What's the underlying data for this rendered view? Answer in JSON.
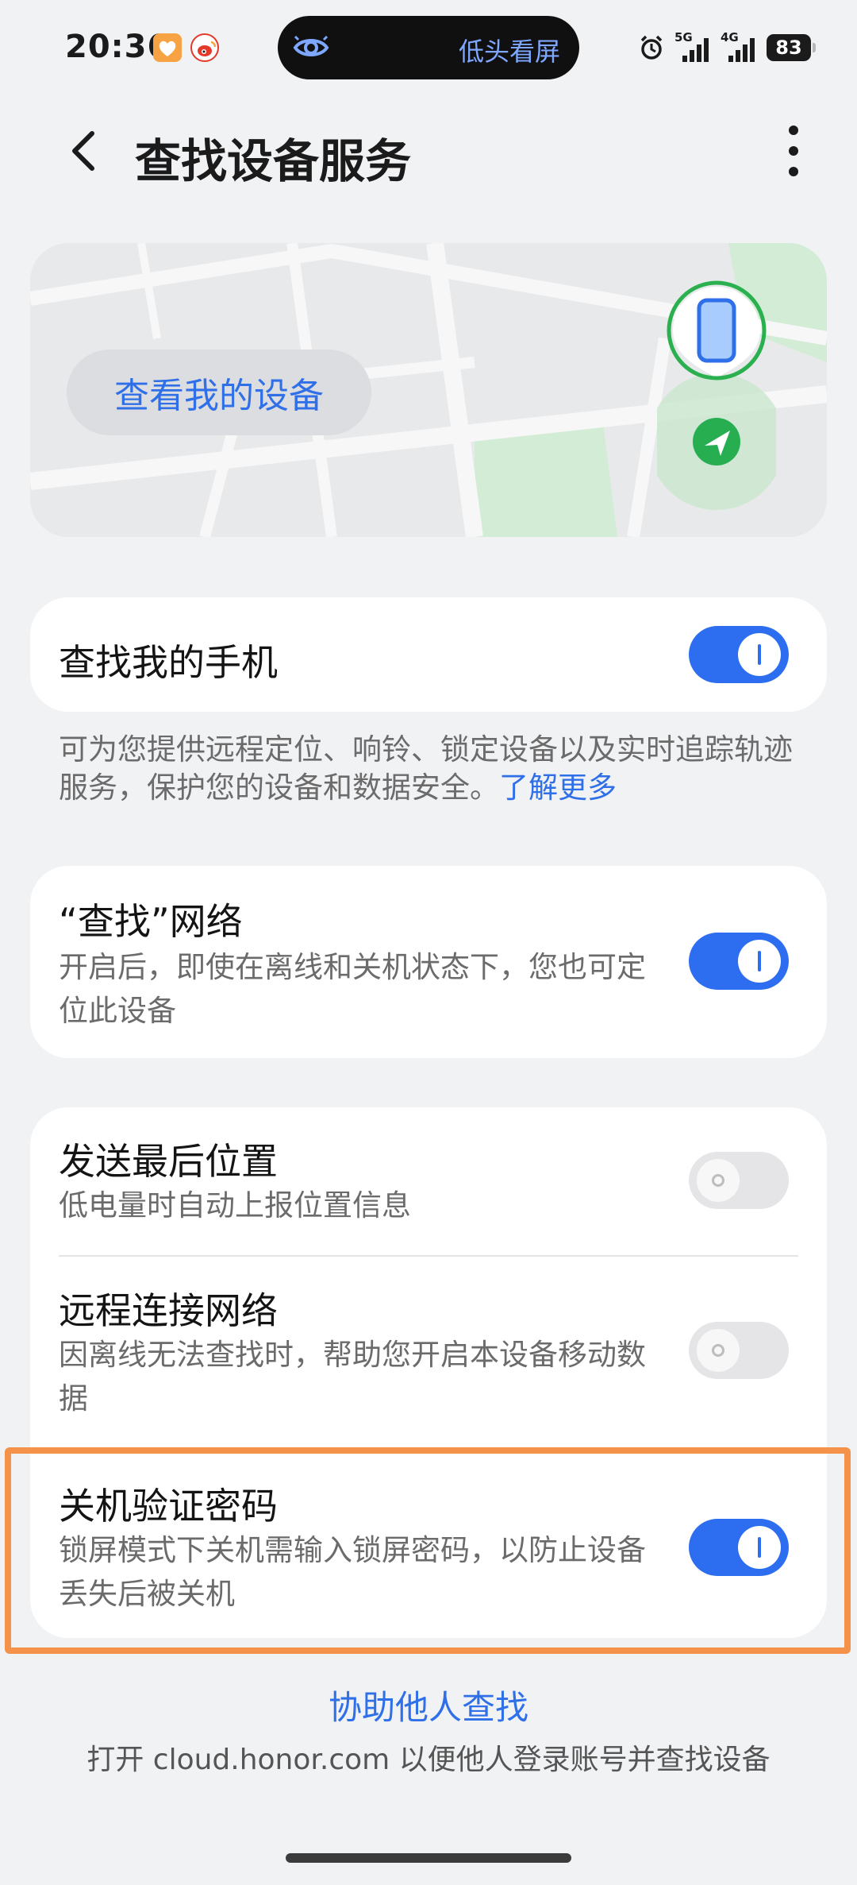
{
  "status_bar": {
    "time": "20:36",
    "island_text": "低头看屏",
    "signal_1": "5G",
    "signal_2": "4G",
    "battery": "83"
  },
  "header": {
    "title": "查找设备服务"
  },
  "map": {
    "view_device_label": "查看我的设备"
  },
  "find_my_phone": {
    "title": "查找我的手机",
    "enabled": true,
    "description": "可为您提供远程定位、响铃、锁定设备以及实时追踪轨迹服务，保护您的设备和数据安全。",
    "learn_more": "了解更多"
  },
  "find_network": {
    "title": "“查找”网络",
    "description": "开启后，即使在离线和关机状态下，您也可定位此设备",
    "enabled": true
  },
  "settings": [
    {
      "title": "发送最后位置",
      "description": "低电量时自动上报位置信息",
      "enabled": false
    },
    {
      "title": "远程连接网络",
      "description": "因离线无法查找时，帮助您开启本设备移动数据",
      "enabled": false
    },
    {
      "title": "关机验证密码",
      "description": "锁屏模式下关机需输入锁屏密码，以防止设备丢失后被关机",
      "enabled": true
    }
  ],
  "assist": {
    "link": "协助他人查找",
    "description": "打开 cloud.honor.com 以便他人登录账号并查找设备"
  },
  "colors": {
    "accent": "#2d6ef0",
    "highlight": "#f5924a",
    "background": "#f1f2f4"
  }
}
